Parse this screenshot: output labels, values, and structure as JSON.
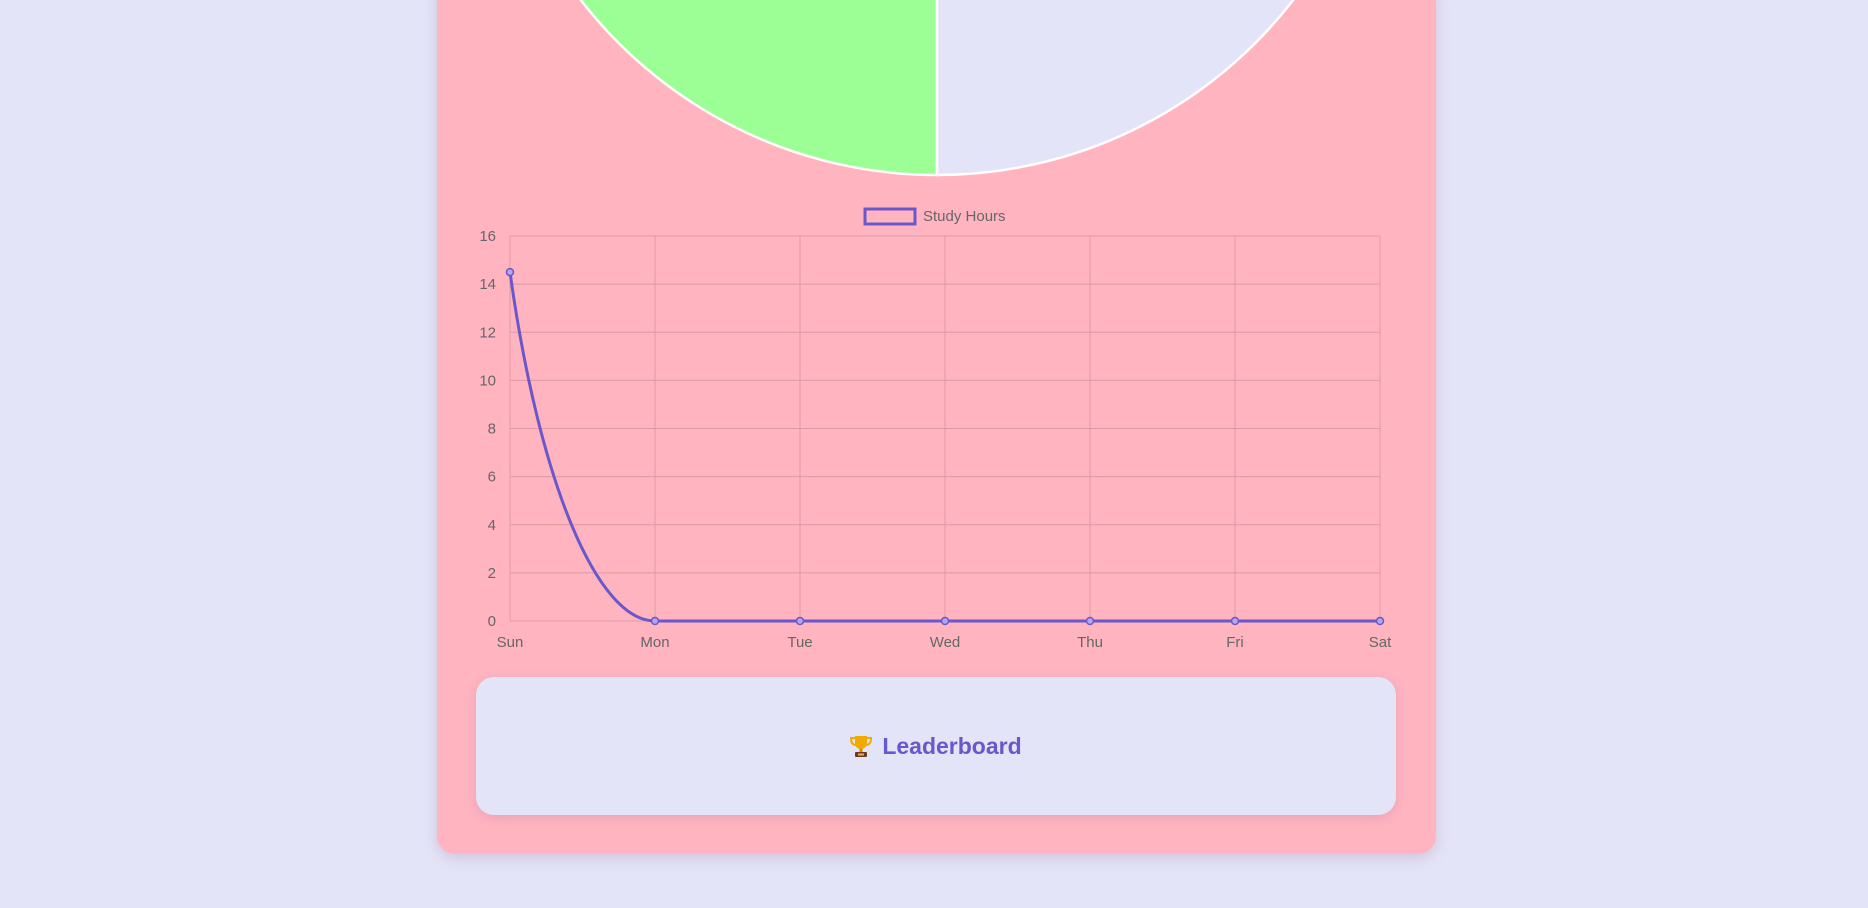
{
  "pie_chart": {
    "type": "pie",
    "colors": {
      "slice_green": "#9bff96",
      "slice_lavender": "#e4e4f8",
      "slice_pink": "#ffb4c0",
      "border": "#ffffff"
    }
  },
  "chart_data": {
    "type": "line",
    "categories": [
      "Sun",
      "Mon",
      "Tue",
      "Wed",
      "Thu",
      "Fri",
      "Sat"
    ],
    "series": [
      {
        "name": "Study Hours",
        "values": [
          14.5,
          0,
          0,
          0,
          0,
          0,
          0
        ]
      }
    ],
    "ylim": [
      0,
      16
    ],
    "yticks": [
      0,
      2,
      4,
      6,
      8,
      10,
      12,
      14,
      16
    ],
    "grid": true,
    "legend": "top-center",
    "line_color": "#6a57c9",
    "grid_color": "#dc9aa8",
    "tick_color": "#666666"
  },
  "leaderboard": {
    "icon": "trophy-icon",
    "title": "Leaderboard",
    "title_color": "#6a57c9"
  }
}
